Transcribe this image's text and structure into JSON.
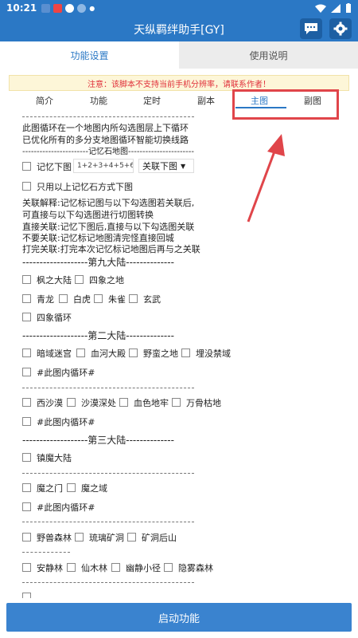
{
  "status": {
    "time": "10:21"
  },
  "app": {
    "title": "天纵羁绊助手[GY]"
  },
  "tabs": [
    {
      "label": "功能设置"
    },
    {
      "label": "使用说明"
    }
  ],
  "notice": "注意：该脚本不支持当前手机分辨率，请联系作者！",
  "subtabs": [
    "简介",
    "功能",
    "定时",
    "副本",
    "主图",
    "副图"
  ],
  "content": {
    "intro1": "此图循环在一个地图内所勾选图层上下循环",
    "intro2": "已优化所有的多分支地图循环智能切换线路",
    "memory_header": "-----------------------记忆石地图-----------------------",
    "memory_label": "记忆下图",
    "memory_input_placeholder": "1+2+3+4+5+6",
    "memory_select": "关联下图",
    "only_above": "只用以上记忆石方式下图",
    "explain1": "关联解释:记忆标记图与以下勾选图若关联后,",
    "explain2": "可直接与以下勾选图进行切图转换",
    "explain3": "直接关联:记忆下图后,直接与以下勾选图关联",
    "explain4": "不要关联:记忆标记地图清完怪直接回城",
    "explain5": "打完关联:打完本次记忆标记地图后再与之关联",
    "continent9": "-------------------第九大陆--------------",
    "c9_row1": [
      "枫之大陆",
      "四象之地"
    ],
    "c9_row2": [
      "青龙",
      "白虎",
      "朱雀",
      "玄武"
    ],
    "c9_row3": [
      "四象循环"
    ],
    "continent2": "-------------------第二大陆--------------",
    "c2_row1": [
      "暗域迷宫",
      "血河大殿",
      "野蛮之地",
      "埋没禁域"
    ],
    "loop": "#此图内循环#",
    "desert_row": [
      "西沙漠",
      "沙漠深处",
      "血色地牢",
      "万骨枯地"
    ],
    "continent3": "-------------------第三大陆--------------",
    "c3_row1": [
      "镇魔大陆"
    ],
    "demon_row": [
      "魔之门",
      "魔之域"
    ],
    "forest_row": [
      "野兽森林",
      "琉璃矿洞",
      "矿洞后山"
    ],
    "quiet_row": [
      "安静林",
      "仙木林",
      "幽静小径",
      "隐雾森林"
    ]
  },
  "start_button": "启动功能"
}
